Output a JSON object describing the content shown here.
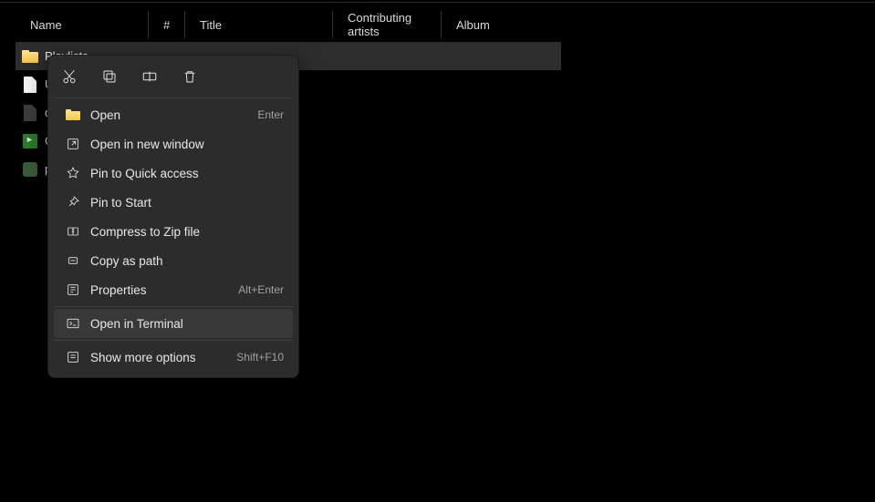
{
  "columns": {
    "name": "Name",
    "number": "#",
    "title": "Title",
    "artists": "Contributing artists",
    "album": "Album"
  },
  "rows": [
    {
      "name": "Playlists",
      "type": "folder",
      "selected": true
    },
    {
      "name": "U",
      "type": "file"
    },
    {
      "name": "d",
      "type": "file-dark"
    },
    {
      "name": "C",
      "type": "playlist"
    },
    {
      "name": "pa",
      "type": "db"
    }
  ],
  "menu": {
    "open": "Open",
    "open_shortcut": "Enter",
    "open_new": "Open in new window",
    "pin_quick": "Pin to Quick access",
    "pin_start": "Pin to Start",
    "compress": "Compress to Zip file",
    "copy_path": "Copy as path",
    "properties": "Properties",
    "properties_shortcut": "Alt+Enter",
    "terminal": "Open in Terminal",
    "more": "Show more options",
    "more_shortcut": "Shift+F10"
  }
}
